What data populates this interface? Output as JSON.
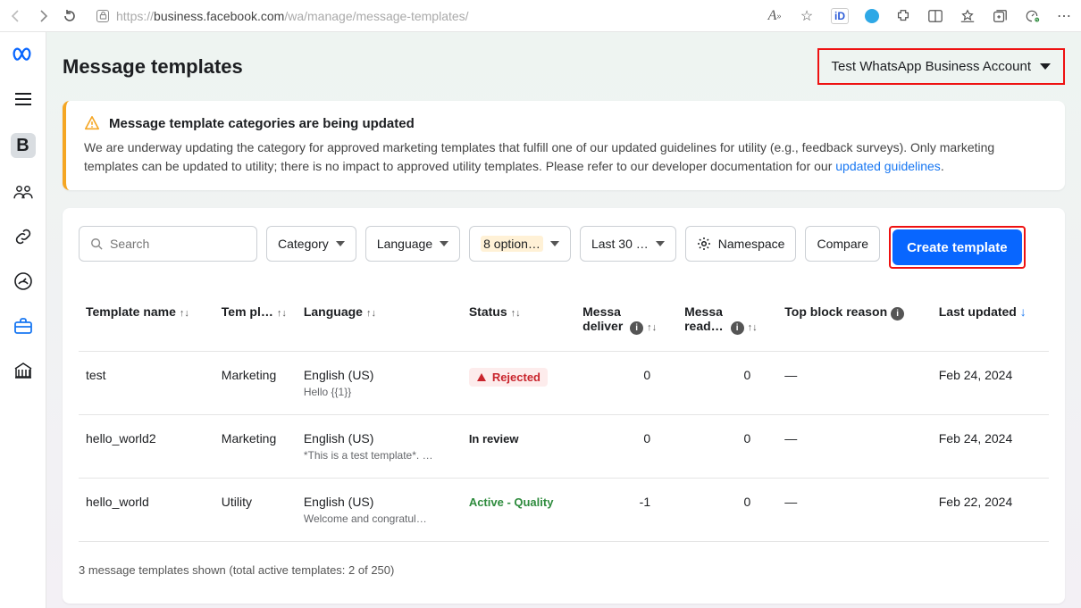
{
  "browser": {
    "url_prefix": "https://",
    "url_host": "business.facebook.com",
    "url_path": "/wa/manage/message-templates/",
    "star": "☆"
  },
  "sidebar": {
    "logo": "∞",
    "items": [
      "menu",
      "B",
      "people",
      "link",
      "gauge",
      "briefcase",
      "bank"
    ]
  },
  "header": {
    "title": "Message templates",
    "account": "Test WhatsApp Business Account"
  },
  "alert": {
    "title": "Message template categories are being updated",
    "body_a": "We are underway updating the category for approved marketing templates that fulfill one of our updated guidelines for utility (e.g., feedback surveys). Only marketing templates can be updated to utility; there is no impact to approved utility templates. Please refer to our developer documentation for our ",
    "link": "updated guidelines",
    "body_b": "."
  },
  "toolbar": {
    "search_placeholder": "Search",
    "category": "Category",
    "language": "Language",
    "options": "8 option…",
    "daterange": "Last 30 …",
    "namespace": "Namespace",
    "compare": "Compare",
    "create": "Create template"
  },
  "columns": {
    "name": "Template name",
    "template": "Tem pl…",
    "language": "Language",
    "status": "Status",
    "delivered_a": "Messa",
    "delivered_b": "deliver",
    "read_a": "Messa",
    "read_b": "read…",
    "block": "Top block reason",
    "updated": "Last updated"
  },
  "rows": [
    {
      "name": "test",
      "category": "Marketing",
      "language": "English (US)",
      "preview": "Hello {{1}}",
      "status_type": "rejected",
      "status_label": "Rejected",
      "delivered": "0",
      "read": "0",
      "block": "—",
      "updated": "Feb 24, 2024"
    },
    {
      "name": "hello_world2",
      "category": "Marketing",
      "language": "English (US)",
      "preview": "*This is a test template*. …",
      "status_type": "review",
      "status_label": "In review",
      "delivered": "0",
      "read": "0",
      "block": "—",
      "updated": "Feb 24, 2024"
    },
    {
      "name": "hello_world",
      "category": "Utility",
      "language": "English (US)",
      "preview": "Welcome and congratul…",
      "status_type": "active",
      "status_label": "Active - Quality",
      "delivered": "-1",
      "read": "0",
      "block": "—",
      "updated": "Feb 22, 2024"
    }
  ],
  "footer": "3 message templates shown (total active templates: 2 of 250)"
}
